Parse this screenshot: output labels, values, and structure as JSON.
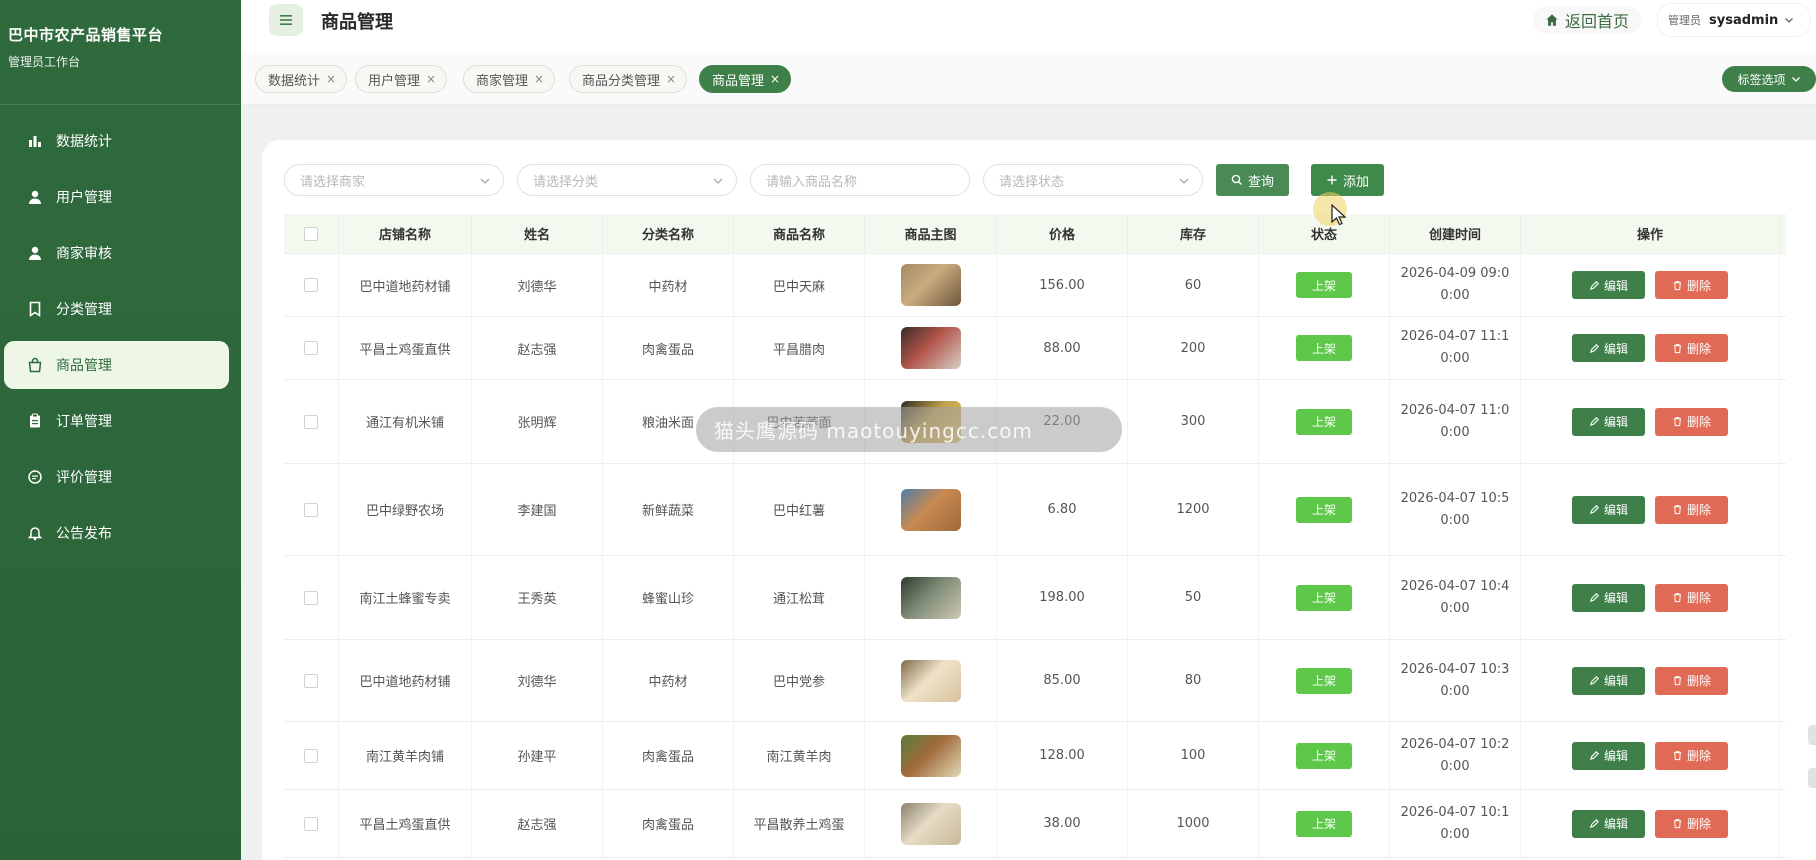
{
  "brand": {
    "title": "巴中市农产品销售平台",
    "subtitle": "管理员工作台"
  },
  "menu": [
    {
      "label": "数据统计",
      "icon": "bar-chart-icon"
    },
    {
      "label": "用户管理",
      "icon": "user-icon"
    },
    {
      "label": "商家审核",
      "icon": "user-icon"
    },
    {
      "label": "分类管理",
      "icon": "bookmark-icon"
    },
    {
      "label": "商品管理",
      "icon": "bag-icon"
    },
    {
      "label": "订单管理",
      "icon": "clipboard-icon"
    },
    {
      "label": "评价管理",
      "icon": "chat-icon"
    },
    {
      "label": "公告发布",
      "icon": "bell-icon"
    }
  ],
  "header": {
    "title": "商品管理",
    "home_label": "返回首页",
    "role_label": "管理员",
    "username": "sysadmin"
  },
  "tabs": [
    {
      "label": "数据统计",
      "close": "×"
    },
    {
      "label": "用户管理",
      "close": "×"
    },
    {
      "label": "商家管理",
      "close": "×"
    },
    {
      "label": "商品分类管理",
      "close": "×"
    },
    {
      "label": "商品管理",
      "close": "×"
    }
  ],
  "tab_options_label": "标签选项",
  "filters": {
    "merchant_placeholder": "请选择商家",
    "category_placeholder": "请选择分类",
    "name_placeholder": "请输入商品名称",
    "status_placeholder": "请选择状态",
    "query_label": "查询",
    "add_label": "添加"
  },
  "table": {
    "columns": [
      "店铺名称",
      "姓名",
      "分类名称",
      "商品名称",
      "商品主图",
      "价格",
      "库存",
      "状态",
      "创建时间",
      "操作"
    ],
    "edit_label": "编辑",
    "delete_label": "删除",
    "rows": [
      {
        "shop": "巴中道地药材铺",
        "owner": "刘德华",
        "category": "中药材",
        "product": "巴中天麻",
        "price": "156.00",
        "stock": "60",
        "status": "上架",
        "time1": "2026-04-09 09:0",
        "time2": "0:00"
      },
      {
        "shop": "平昌土鸡蛋直供",
        "owner": "赵志强",
        "category": "肉禽蛋品",
        "product": "平昌腊肉",
        "price": "88.00",
        "stock": "200",
        "status": "上架",
        "time1": "2026-04-07 11:1",
        "time2": "0:00"
      },
      {
        "shop": "通江有机米铺",
        "owner": "张明辉",
        "category": "粮油米面",
        "product": "巴中苦荞面",
        "price": "22.00",
        "stock": "300",
        "status": "上架",
        "time1": "2026-04-07 11:0",
        "time2": "0:00"
      },
      {
        "shop": "巴中绿野农场",
        "owner": "李建国",
        "category": "新鲜蔬菜",
        "product": "巴中红薯",
        "price": "6.80",
        "stock": "1200",
        "status": "上架",
        "time1": "2026-04-07 10:5",
        "time2": "0:00"
      },
      {
        "shop": "南江土蜂蜜专卖",
        "owner": "王秀英",
        "category": "蜂蜜山珍",
        "product": "通江松茸",
        "price": "198.00",
        "stock": "50",
        "status": "上架",
        "time1": "2026-04-07 10:4",
        "time2": "0:00"
      },
      {
        "shop": "巴中道地药材铺",
        "owner": "刘德华",
        "category": "中药材",
        "product": "巴中党参",
        "price": "85.00",
        "stock": "80",
        "status": "上架",
        "time1": "2026-04-07 10:3",
        "time2": "0:00"
      },
      {
        "shop": "南江黄羊肉铺",
        "owner": "孙建平",
        "category": "肉禽蛋品",
        "product": "南江黄羊肉",
        "price": "128.00",
        "stock": "100",
        "status": "上架",
        "time1": "2026-04-07 10:2",
        "time2": "0:00"
      },
      {
        "shop": "平昌土鸡蛋直供",
        "owner": "赵志强",
        "category": "肉禽蛋品",
        "product": "平昌散养土鸡蛋",
        "price": "38.00",
        "stock": "1000",
        "status": "上架",
        "time1": "2026-04-07 10:1",
        "time2": "0:00"
      }
    ]
  },
  "watermark": "猫头鹰源码 maotouyingcc.com",
  "colors": {
    "primary": "#3f7f4a",
    "sidebar": "#2f6a3d",
    "status": "#5ec84a",
    "danger": "#e06a55"
  }
}
